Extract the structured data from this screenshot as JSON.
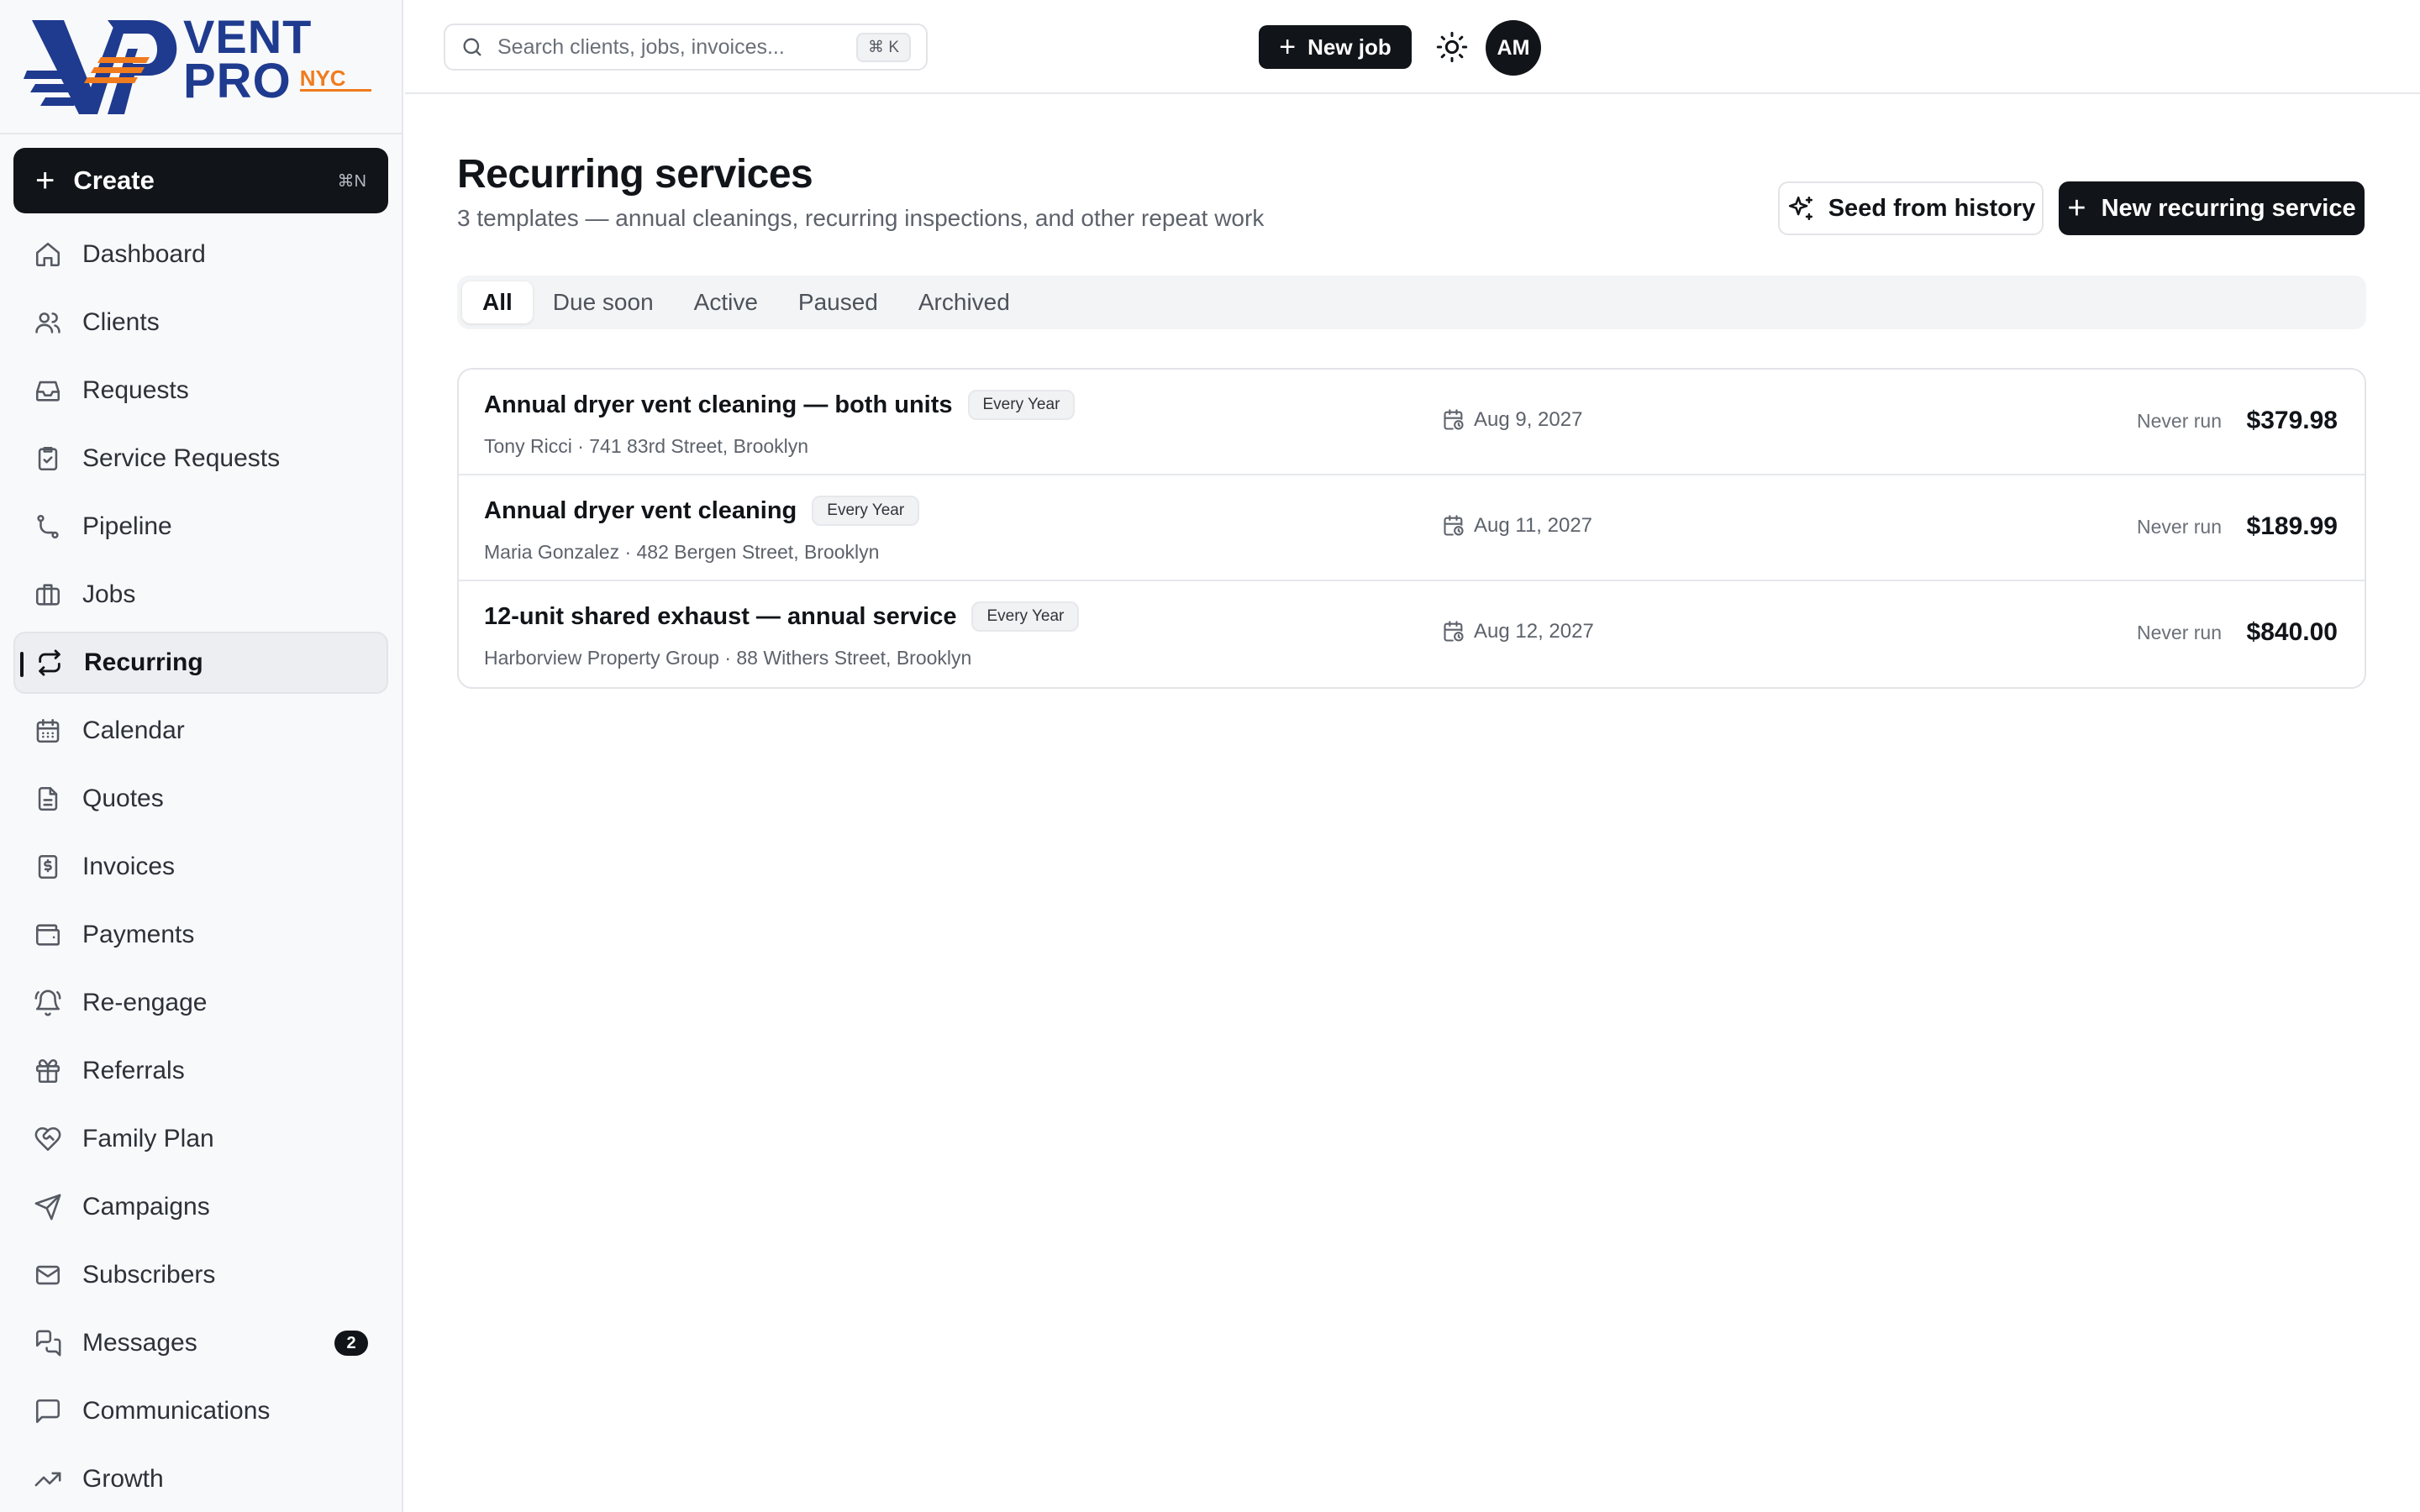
{
  "brand": {
    "line1": "VENT",
    "line2": "PRO",
    "tag": "NYC",
    "colors": {
      "navy": "#1f3b8f",
      "orange": "#f07c1e"
    }
  },
  "sidebar": {
    "create": {
      "label": "Create",
      "shortcut": "⌘N"
    },
    "items": [
      {
        "label": "Dashboard",
        "icon": "home-icon"
      },
      {
        "label": "Clients",
        "icon": "users-icon"
      },
      {
        "label": "Requests",
        "icon": "inbox-icon"
      },
      {
        "label": "Service Requests",
        "icon": "clipboard-check-icon"
      },
      {
        "label": "Pipeline",
        "icon": "git-branch-icon"
      },
      {
        "label": "Jobs",
        "icon": "briefcase-icon"
      },
      {
        "label": "Recurring",
        "icon": "repeat-icon",
        "active": true
      },
      {
        "label": "Calendar",
        "icon": "calendar-icon"
      },
      {
        "label": "Quotes",
        "icon": "file-text-icon"
      },
      {
        "label": "Invoices",
        "icon": "invoice-dollar-icon"
      },
      {
        "label": "Payments",
        "icon": "wallet-icon"
      },
      {
        "label": "Re-engage",
        "icon": "bell-icon"
      },
      {
        "label": "Referrals",
        "icon": "gift-icon"
      },
      {
        "label": "Family Plan",
        "icon": "heart-handshake-icon"
      },
      {
        "label": "Campaigns",
        "icon": "send-icon"
      },
      {
        "label": "Subscribers",
        "icon": "mail-icon"
      },
      {
        "label": "Messages",
        "icon": "messages-icon",
        "badge": "2"
      },
      {
        "label": "Communications",
        "icon": "message-square-icon"
      },
      {
        "label": "Growth",
        "icon": "trending-up-icon"
      }
    ]
  },
  "topbar": {
    "search_placeholder": "Search clients, jobs, invoices...",
    "search_shortcut": "⌘ K",
    "new_job_label": "New job",
    "avatar_initials": "AM"
  },
  "main": {
    "title": "Recurring services",
    "subtitle": "3 templates — annual cleanings, recurring inspections, and other repeat work",
    "seed_label": "Seed from history",
    "new_recurring_label": "New recurring service",
    "tabs": [
      {
        "label": "All",
        "active": true
      },
      {
        "label": "Due soon"
      },
      {
        "label": "Active"
      },
      {
        "label": "Paused"
      },
      {
        "label": "Archived"
      }
    ],
    "rows": [
      {
        "title": "Annual dryer vent cleaning — both units",
        "frequency": "Every Year",
        "client": "Tony Ricci · 741 83rd Street, Brooklyn",
        "next_date": "Aug 9, 2027",
        "last_run": "Never run",
        "price": "$379.98"
      },
      {
        "title": "Annual dryer vent cleaning",
        "frequency": "Every Year",
        "client": "Maria Gonzalez · 482 Bergen Street, Brooklyn",
        "next_date": "Aug 11, 2027",
        "last_run": "Never run",
        "price": "$189.99"
      },
      {
        "title": "12-unit shared exhaust — annual service",
        "frequency": "Every Year",
        "client": "Harborview Property Group · 88 Withers Street, Brooklyn",
        "next_date": "Aug 12, 2027",
        "last_run": "Never run",
        "price": "$840.00"
      }
    ]
  }
}
